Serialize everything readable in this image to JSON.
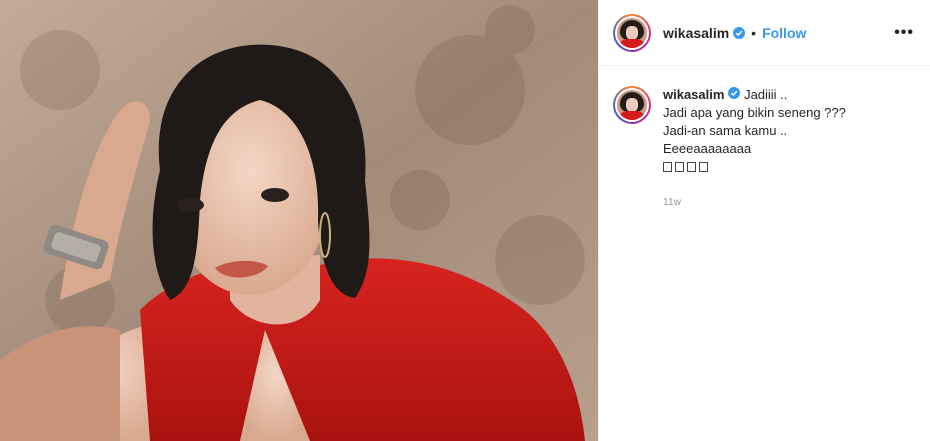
{
  "post": {
    "username": "wikasalim",
    "follow_label": "Follow",
    "separator": "•",
    "more_label": "•••",
    "caption": {
      "lead": "Jadiiii ..",
      "lines": [
        "Jadi apa yang bikin seneng ???",
        "Jadi-an sama kamu ..",
        "Eeeeaaaaaaaa"
      ],
      "emoji_line": "□□□□"
    },
    "timestamp": "11w"
  },
  "colors": {
    "accent": "#3897f0",
    "verified": "#3897f0",
    "text": "#262626",
    "muted": "#999999",
    "border": "#efefef"
  }
}
